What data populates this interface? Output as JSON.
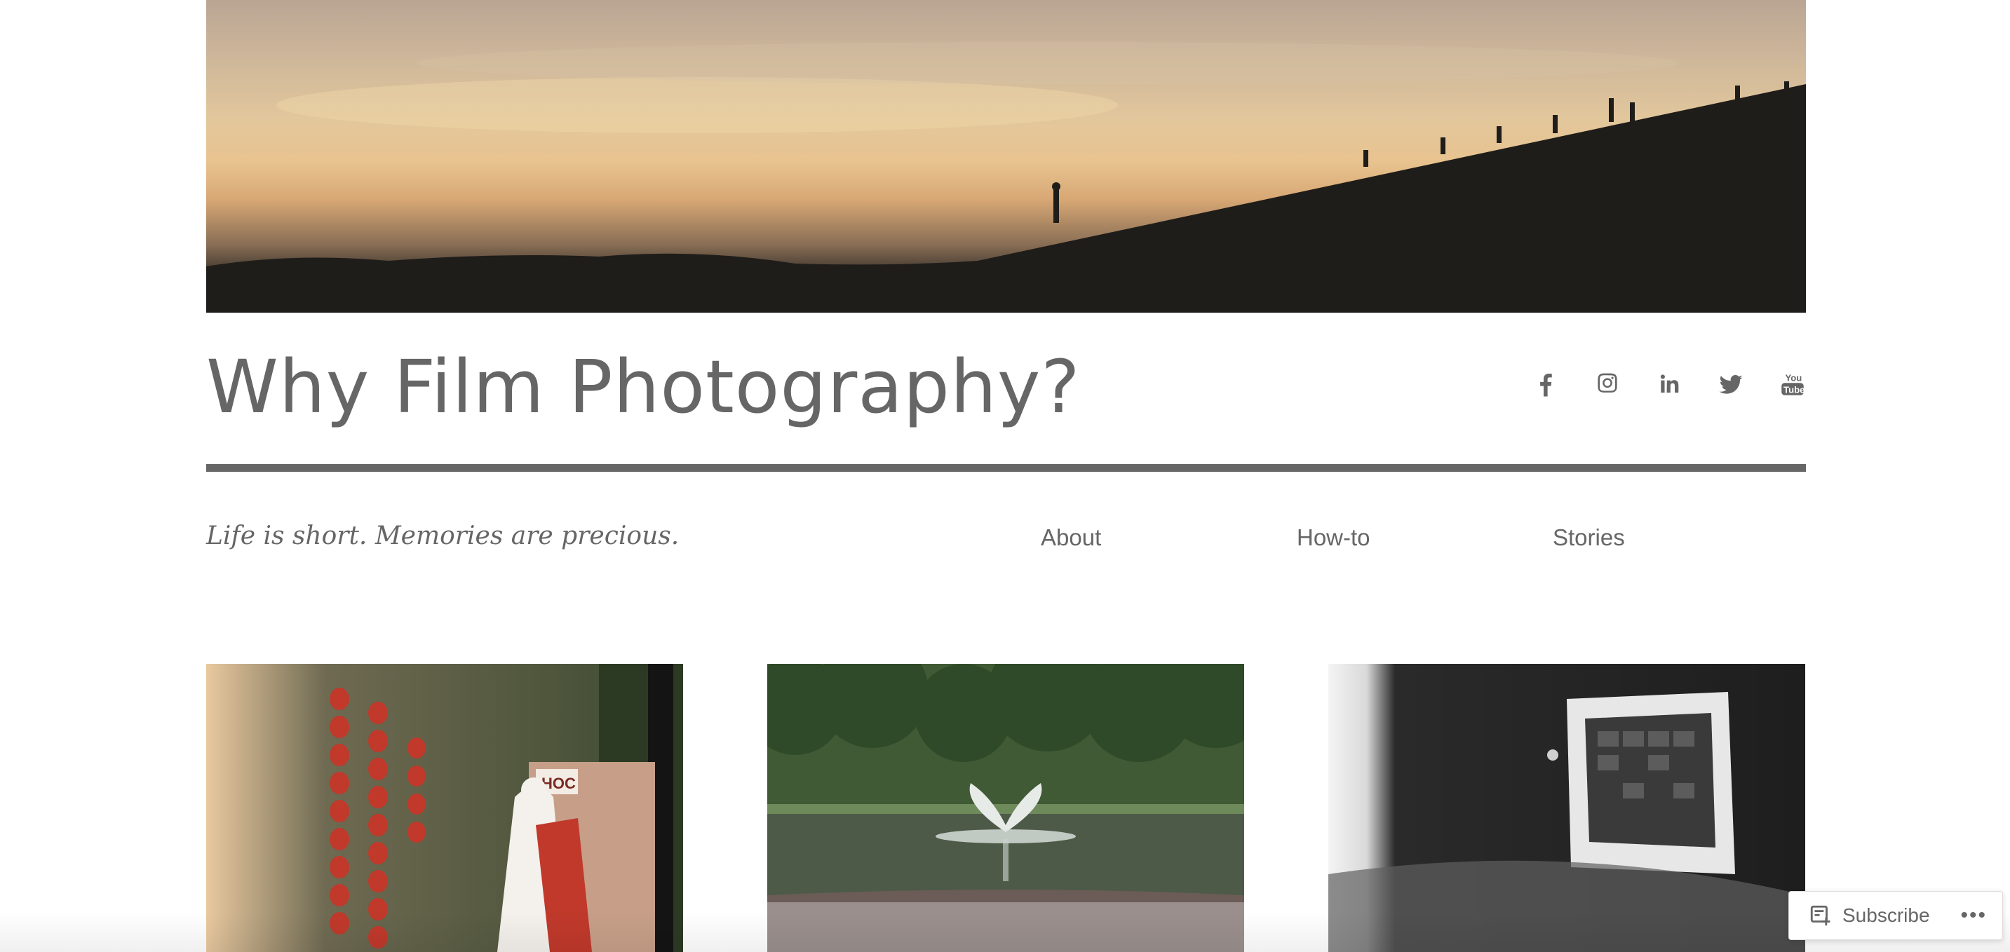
{
  "site": {
    "title": "Why Film Photography?",
    "tagline": "Life is short. Memories are precious."
  },
  "nav": {
    "items": [
      {
        "label": "About"
      },
      {
        "label": "How-to"
      },
      {
        "label": "Stories"
      }
    ]
  },
  "social": {
    "icons": [
      "facebook-icon",
      "instagram-icon",
      "linkedin-icon",
      "twitter-icon",
      "youtube-icon"
    ],
    "youtube_text_top": "You",
    "youtube_text_bottom": "Tube"
  },
  "posts": {
    "thumbnails": [
      {
        "alt_subject": "red lanterns and statue",
        "sign_text": "HOC"
      },
      {
        "alt_subject": "pond fountain"
      },
      {
        "alt_subject": "black and white framed picture"
      }
    ]
  },
  "subscribe": {
    "label": "Subscribe",
    "more": "•••"
  },
  "colors": {
    "text": "#666666",
    "rule": "#666666",
    "background": "#ffffff"
  }
}
